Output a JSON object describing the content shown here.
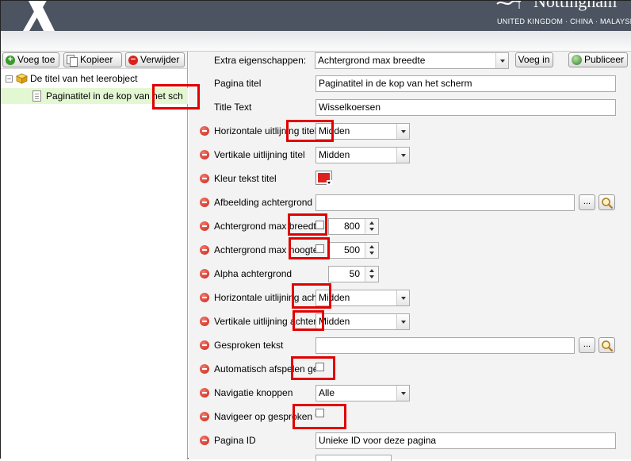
{
  "brand": {
    "name": "Nottingham",
    "sub": "UNITED KINGDOM · CHINA · MALAYSIA"
  },
  "toolbar": {
    "add_label": "Voeg toe",
    "copy_label": "Kopieer",
    "delete_label": "Verwijder",
    "extra_label": "Extra eigenschappen:",
    "extra_selected": "Achtergrond max breedte",
    "insert_label": "Voeg in",
    "publish_label": "Publiceer"
  },
  "tree": {
    "root": "De titel van het leerobject",
    "child": "Paginatitel in de kop van het sch"
  },
  "properties": {
    "page_title": {
      "label": "Pagina titel",
      "value": "Paginatitel in de kop van het scherm"
    },
    "title_text": {
      "label": "Title Text",
      "value": "Wisselkoersen"
    },
    "h_align_title": {
      "label": "Horizontale uitlijning titel",
      "value": "Midden"
    },
    "v_align_title": {
      "label": "Vertikale uitlijning titel",
      "value": "Midden"
    },
    "text_color_title": {
      "label": "Kleur tekst titel",
      "color": "#e0201c"
    },
    "bg_image": {
      "label": "Afbeelding achtergrond",
      "value": "",
      "browse": "..."
    },
    "bg_max_width": {
      "label": "Achtergrond max breedte",
      "value": "800"
    },
    "bg_max_height": {
      "label": "Achtergrond max hoogte",
      "value": "500"
    },
    "alpha_bg": {
      "label": "Alpha achtergrond",
      "value": "50"
    },
    "h_align_bg": {
      "label": "Horizontale uitlijning achtergrond",
      "value": "Midden"
    },
    "v_align_bg": {
      "label": "Vertikale uitlijning achtergrond",
      "value": "Midden"
    },
    "spoken_text": {
      "label": "Gesproken tekst",
      "value": "",
      "browse": "..."
    },
    "autoplay": {
      "label": "Automatisch afspelen gesproken tekst"
    },
    "nav_buttons": {
      "label": "Navigatie knoppen",
      "value": "Alle"
    },
    "navigate_spoken": {
      "label": "Navigeer op gesproken tekst"
    },
    "page_id": {
      "label": "Pagina ID",
      "value": "Unieke ID voor deze pagina"
    }
  },
  "colors": {
    "highlight": "#e10000",
    "banner": "#4b5460",
    "tree_selected": "#e3f8d2"
  }
}
